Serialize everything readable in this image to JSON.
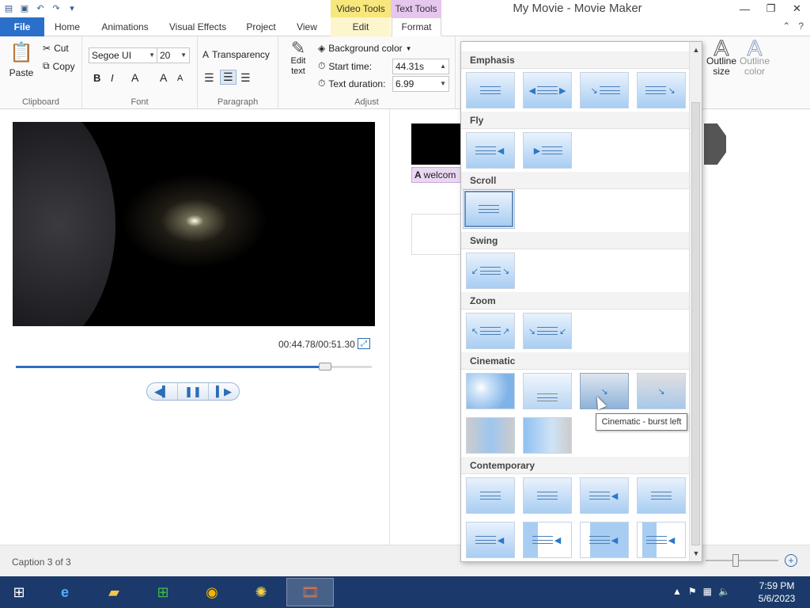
{
  "window": {
    "title": "My Movie - Movie Maker"
  },
  "context_tabs": {
    "video": "Video Tools",
    "text": "Text Tools"
  },
  "tabs": [
    "File",
    "Home",
    "Animations",
    "Visual Effects",
    "Project",
    "View",
    "Edit",
    "Format"
  ],
  "ribbon": {
    "clipboard": {
      "paste": "Paste",
      "cut": "Cut",
      "copy": "Copy",
      "label": "Clipboard"
    },
    "font": {
      "family": "Segoe UI",
      "size": "20",
      "bold": "B",
      "italic": "I",
      "color": "A",
      "grow": "A",
      "shrink": "A",
      "label": "Font"
    },
    "paragraph": {
      "transparency": "Transparency",
      "label": "Paragraph"
    },
    "adjust": {
      "edit_text": "Edit text",
      "background_color": "Background color",
      "start_time_label": "Start time:",
      "start_time_value": "44.31s",
      "text_duration_label": "Text duration:",
      "text_duration_value": "6.99",
      "label": "Adjust"
    },
    "outline": {
      "size": "Outline size",
      "color": "Outline color"
    }
  },
  "player": {
    "time": "00:44.78/00:51.30",
    "progress": 0.868
  },
  "storyboard": {
    "caption_chip": "welcom"
  },
  "gallery": {
    "sections": [
      {
        "name": "Emphasis",
        "count": 4
      },
      {
        "name": "Fly",
        "count": 2
      },
      {
        "name": "Scroll",
        "count": 1
      },
      {
        "name": "Swing",
        "count": 1
      },
      {
        "name": "Zoom",
        "count": 2
      },
      {
        "name": "Cinematic",
        "count": 6
      },
      {
        "name": "Contemporary",
        "count": 8
      }
    ],
    "tooltip": "Cinematic - burst left"
  },
  "status": {
    "caption": "Caption 3 of 3"
  },
  "clock": {
    "time": "7:59 PM",
    "date": "5/6/2023"
  }
}
